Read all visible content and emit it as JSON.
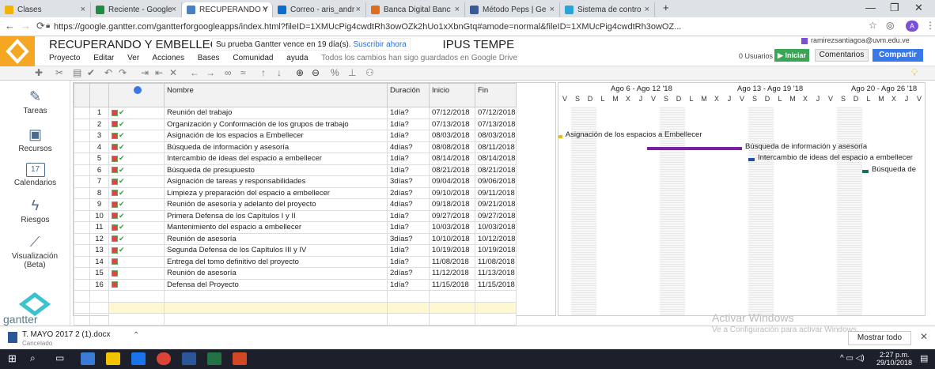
{
  "tabs": [
    {
      "label": "Clases",
      "color": "#f2b400"
    },
    {
      "label": "Reciente - Google",
      "color": "#f4b400"
    },
    {
      "label": "RECUPERANDO Y",
      "color": "#4a7fc1"
    },
    {
      "label": "Correo - aris_andr",
      "color": "#0a6ed1"
    },
    {
      "label": "Banca Digital Banc",
      "color": "#e06b1a"
    },
    {
      "label": "Método Peps | Ge",
      "color": "#3b5998"
    },
    {
      "label": "Sistema de contro",
      "color": "#2aa3d6"
    }
  ],
  "url": "https://google.gantter.com/gantterforgoogleapps/index.html?fileID=1XMUcPig4cwdtRh3owOZk2hUo1xXbnGtq#amode=normal&fileID=1XMUcPig4cwdtRh3owOZ...",
  "header": {
    "project_title": "RECUPERANDO Y EMBELLECIENDO LAS ÁRE",
    "project_title_end": "IPUS TEMPE",
    "trial_text": "Su prueba Gantter vence en 19 día(s).",
    "trial_link": "Suscribir ahora",
    "saved_status": "Todos los cambios han sigo guardados en Google Drive",
    "menu": [
      "Proyecto",
      "Editar",
      "Ver",
      "Acciones",
      "Bases",
      "Comunidad",
      "ayuda"
    ],
    "users": "0 Usuarios en ...",
    "start_button": "Iniciar",
    "comments": "Comentarios",
    "share": "Compartir",
    "account": "ramirezsantiagoa@uvm.edu.ve"
  },
  "sidebar": [
    {
      "label": "Tareas",
      "icon": "edit-icon"
    },
    {
      "label": "Recursos",
      "icon": "resources-icon"
    },
    {
      "label": "Calendarios",
      "icon": "calendar-icon"
    },
    {
      "label": "Riesgos",
      "icon": "lightning-icon"
    },
    {
      "label": "Visualización (Beta)",
      "icon": "chart-icon"
    }
  ],
  "calendar_day": "17",
  "brand": "gantter",
  "grid": {
    "headers": {
      "name": "Nombre",
      "duration": "Duración",
      "start": "Inicio",
      "finish": "Fin"
    },
    "rows": [
      {
        "n": "1",
        "name": "Reunión del trabajo",
        "dur": "1día?",
        "start": "07/12/2018",
        "end": "07/12/2018"
      },
      {
        "n": "2",
        "name": "Organización y Conformación de los grupos de trabajo",
        "dur": "1día?",
        "start": "07/13/2018",
        "end": "07/13/2018"
      },
      {
        "n": "3",
        "name": "Asignación de los espacios a Embellecer",
        "dur": "1día?",
        "start": "08/03/2018",
        "end": "08/03/2018"
      },
      {
        "n": "4",
        "name": "Búsqueda de información y asesoría",
        "dur": "4días?",
        "start": "08/08/2018",
        "end": "08/11/2018"
      },
      {
        "n": "5",
        "name": "Intercambio de ideas del espacio a embellecer",
        "dur": "1día?",
        "start": "08/14/2018",
        "end": "08/14/2018"
      },
      {
        "n": "6",
        "name": "Búsqueda de presupuesto",
        "dur": "1día?",
        "start": "08/21/2018",
        "end": "08/21/2018"
      },
      {
        "n": "7",
        "name": "Asignación de tareas y responsabilidades",
        "dur": "3días?",
        "start": "09/04/2018",
        "end": "09/06/2018"
      },
      {
        "n": "8",
        "name": "Limpieza y preparación del espacio a embellecer",
        "dur": "2días?",
        "start": "09/10/2018",
        "end": "09/11/2018"
      },
      {
        "n": "9",
        "name": "Reunión de asesoría y adelanto del proyecto",
        "dur": "4días?",
        "start": "09/18/2018",
        "end": "09/21/2018"
      },
      {
        "n": "10",
        "name": "Primera Defensa de los Capítulos I y II",
        "dur": "1día?",
        "start": "09/27/2018",
        "end": "09/27/2018"
      },
      {
        "n": "11",
        "name": "Mantenimiento del espacio a embellecer",
        "dur": "1día?",
        "start": "10/03/2018",
        "end": "10/03/2018"
      },
      {
        "n": "12",
        "name": "Reunión de asesoría",
        "dur": "3días?",
        "start": "10/10/2018",
        "end": "10/12/2018"
      },
      {
        "n": "13",
        "name": "Segunda  Defensa de los Capítulos III y IV",
        "dur": "1día?",
        "start": "10/19/2018",
        "end": "10/19/2018"
      },
      {
        "n": "14",
        "name": "Entrega del tomo definitivo del proyecto",
        "dur": "1día?",
        "start": "11/08/2018",
        "end": "11/08/2018"
      },
      {
        "n": "15",
        "name": "Reunión de asesoría",
        "dur": "2días?",
        "start": "11/12/2018",
        "end": "11/13/2018"
      },
      {
        "n": "16",
        "name": "Defensa del Proyecto",
        "dur": "1día?",
        "start": "11/15/2018",
        "end": "11/15/2018"
      }
    ]
  },
  "gantt": {
    "weeks": [
      "Ago 6 - Ago 12 '18",
      "Ago 13 - Ago 19 '18",
      "Ago 20 - Ago 26 '18"
    ],
    "days": [
      "V",
      "S",
      "D",
      "L",
      "M",
      "X",
      "J",
      "V",
      "S",
      "D",
      "L",
      "M",
      "X",
      "J",
      "V",
      "S",
      "D",
      "L",
      "M",
      "X",
      "J",
      "V",
      "S",
      "D",
      "L",
      "M",
      "X",
      "J",
      "V"
    ],
    "labels": {
      "a": "Asignación de los espacios a Embellecer",
      "b": "Búsqueda de información y asesoría",
      "c": "Intercambio de ideas del espacio a embellecer",
      "d": "Búsqueda de"
    }
  },
  "watermark": {
    "title": "Activar Windows",
    "sub": "Ve a Configuración para activar Windows."
  },
  "download": {
    "file": "T. MAYO 2017 2 (1).docx",
    "status": "Cancelado",
    "show_all": "Mostrar todo"
  },
  "clock": {
    "time": "2:27 p.m.",
    "date": "29/10/2018"
  }
}
